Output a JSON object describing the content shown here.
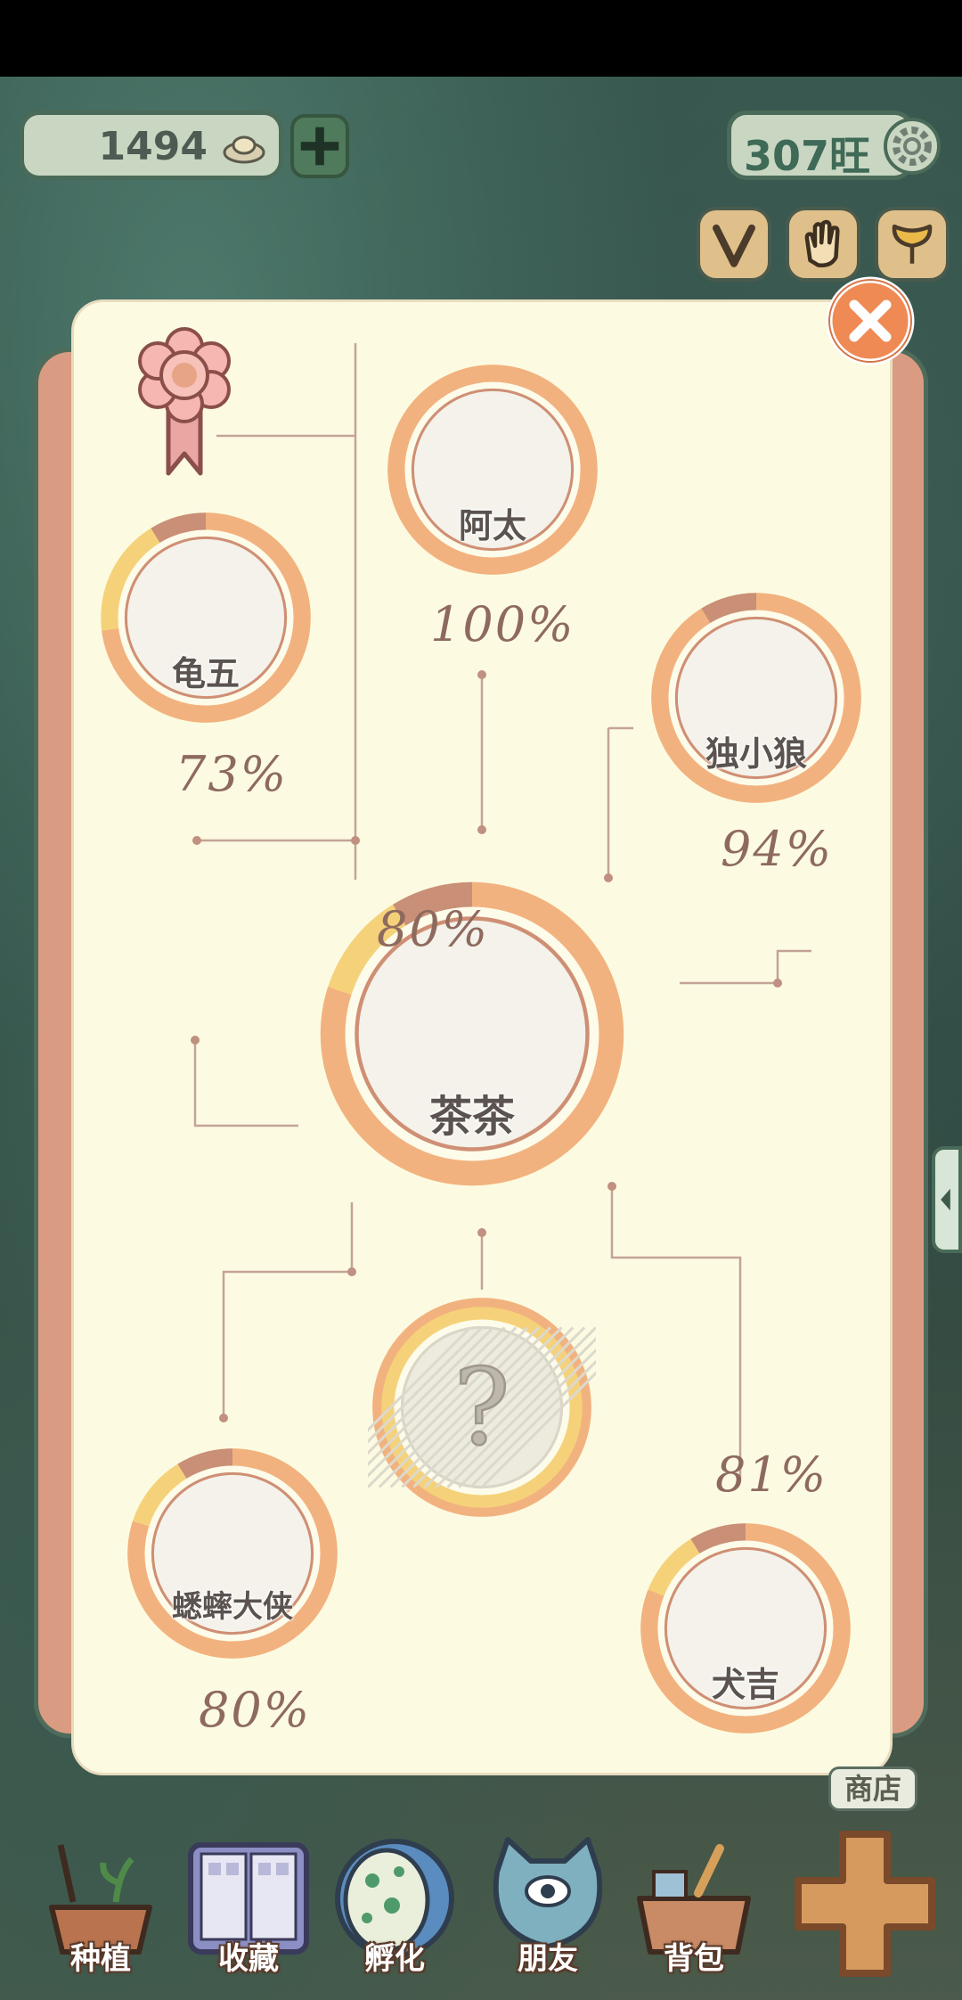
{
  "header": {
    "coins": "1494",
    "wang": "307旺"
  },
  "icons": {
    "coin": "ingot-icon",
    "add": "plus-icon",
    "settings": "gear-icon",
    "vip": "v-badge-icon",
    "hand": "hand-icon",
    "leaf": "ginkgo-leaf-icon",
    "close": "close-icon"
  },
  "colors": {
    "ring_outer": "#f2b27f",
    "ring_brown": "#c98f77",
    "ring_yellow": "#f5d27a",
    "panel": "#fcfbe2",
    "close": "#ef8a55"
  },
  "relations": {
    "center": {
      "name": "茶茶",
      "percent": "80%",
      "progress": 0.8
    },
    "nodes": [
      {
        "id": "atai",
        "name": "阿太",
        "percent": "100%",
        "progress": 1.0
      },
      {
        "id": "guiwu",
        "name": "龟五",
        "percent": "73%",
        "progress": 0.73
      },
      {
        "id": "duxiaolang",
        "name": "独小狼",
        "percent": "94%",
        "progress": 0.94
      },
      {
        "id": "xishuai",
        "name": "蟋蟀大侠",
        "percent": "80%",
        "progress": 0.8
      },
      {
        "id": "unknown",
        "name": "?",
        "percent": "",
        "progress": 0
      },
      {
        "id": "quanji",
        "name": "犬吉",
        "percent": "81%",
        "progress": 0.81
      }
    ]
  },
  "bottom_nav": [
    {
      "label": "种植"
    },
    {
      "label": "收藏"
    },
    {
      "label": "孵化"
    },
    {
      "label": "朋友"
    },
    {
      "label": "背包"
    }
  ],
  "shop_label": "商店"
}
